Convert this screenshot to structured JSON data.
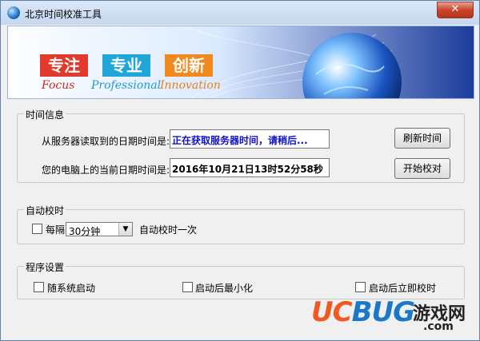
{
  "window": {
    "title": "北京时间校准工具",
    "close_label": "✕"
  },
  "banner": {
    "tags": [
      {
        "zh": "专注",
        "en": "Focus"
      },
      {
        "zh": "专业",
        "en": "Professional"
      },
      {
        "zh": "创新",
        "en": "Innovation"
      }
    ]
  },
  "time_info": {
    "title": "时间信息",
    "server_label": "从服务器读取到的日期时间是:",
    "server_value": "正在获取服务器时间，请稍后...",
    "local_label": "您的电脑上的当前日期时间是:",
    "local_value": "2016年10月21日13时52分58秒",
    "refresh_button": "刷新时间",
    "start_button": "开始校对"
  },
  "auto_sync": {
    "title": "自动校时",
    "every_label": "每隔",
    "interval_value": "30分钟",
    "suffix_label": "自动校时一次"
  },
  "settings": {
    "title": "程序设置",
    "option1": "随系统启动",
    "option2": "启动后最小化",
    "option3": "启动后立即校时"
  },
  "watermark": {
    "uc": "UC",
    "bug": "BUG",
    "cn": "游戏网",
    "com": ".com"
  },
  "colors": {
    "server_value_text": "#1010c8",
    "accent": "#1d6fc9"
  }
}
